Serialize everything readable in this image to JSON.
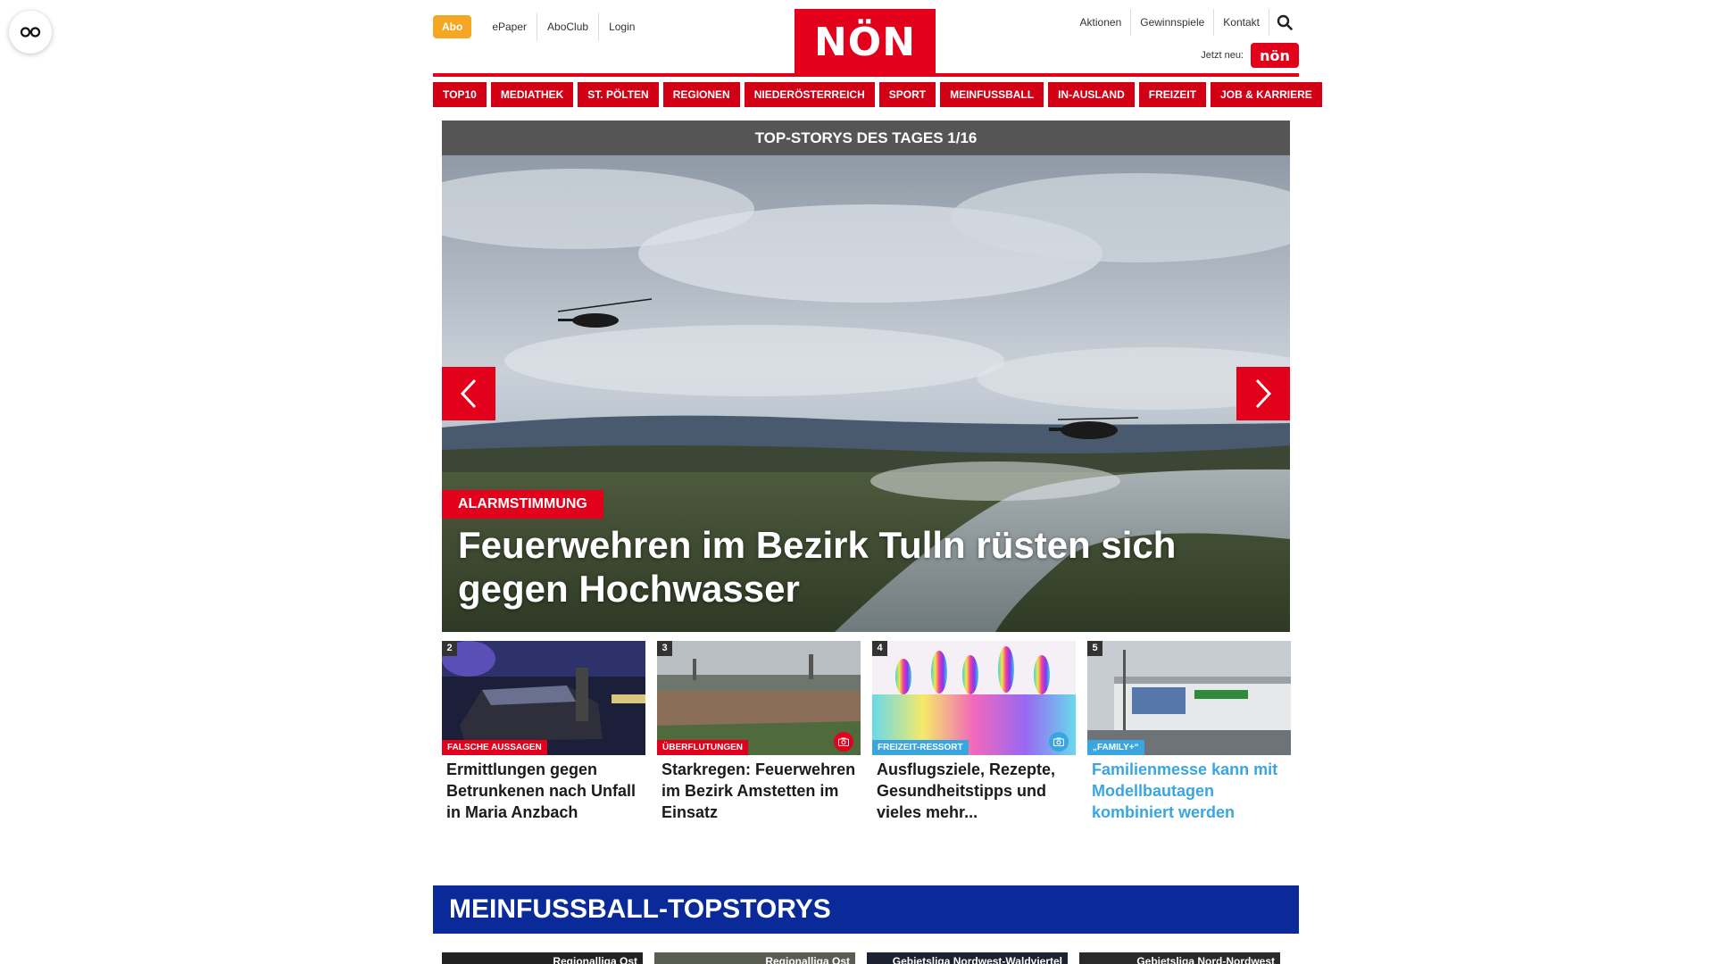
{
  "header": {
    "abo_label": "Abo",
    "top_links": [
      "ePaper",
      "AboClub",
      "Login"
    ],
    "logo_text": "NÖN",
    "right_links": [
      "Aktionen",
      "Gewinnspiele",
      "Kontakt"
    ],
    "jetzt_label": "Jetzt neu:",
    "kleine_badge": "nön",
    "search_icon": "search-icon"
  },
  "nav": [
    "TOP10",
    "MEDIATHEK",
    "ST. PÖLTEN",
    "REGIONEN",
    "NIEDERÖSTERREICH",
    "SPORT",
    "MEINFUSSBALL",
    "IN-AUSLAND",
    "FREIZEIT",
    "JOB & KARRIERE"
  ],
  "topstories": {
    "header": "TOP-STORYS DES TAGES 1/16",
    "hero": {
      "tag": "ALARMSTIMMUNG",
      "title": "Feuerwehren im Bezirk Tulln rüsten sich gegen Hochwasser"
    },
    "cards": [
      {
        "num": "2",
        "tag": "FALSCHE AUSSAGEN",
        "tag_color": "#e2001a",
        "title": "Ermittlungen gegen Betrunkenen nach Unfall in Maria Anzbach",
        "camera": false
      },
      {
        "num": "3",
        "tag": "ÜBERFLUTUNGEN",
        "tag_color": "#e2001a",
        "title": "Starkregen: Feuerwehren im Bezirk Amstetten im Einsatz",
        "camera": true
      },
      {
        "num": "4",
        "tag": "FREIZEIT-RESSORT",
        "tag_color": "#3aa6e0",
        "title": "Ausflugsziele, Rezepte, Gesundheitstipps und vieles mehr...",
        "camera": true
      },
      {
        "num": "5",
        "tag": "„FAMILY+“",
        "tag_color": "#3aa6e0",
        "title": "Familienmesse kann mit Modellbautagen kombiniert werden",
        "camera": false
      }
    ]
  },
  "meinfussball": {
    "header": "MEINFUSSBALL-TOPSTORYS",
    "leagues": [
      "Regionalliga Ost",
      "Regionalliga Ost",
      "Gebietsliga Nordwest-Waldviertel",
      "Gebietsliga Nord-Nordwest"
    ]
  },
  "colors": {
    "brand_red": "#e2001a",
    "nav_red": "#d10014",
    "abo_orange": "#f5a623",
    "freizeit_blue": "#3aa6e0",
    "meinfussball_blue": "#0a2a9a"
  }
}
